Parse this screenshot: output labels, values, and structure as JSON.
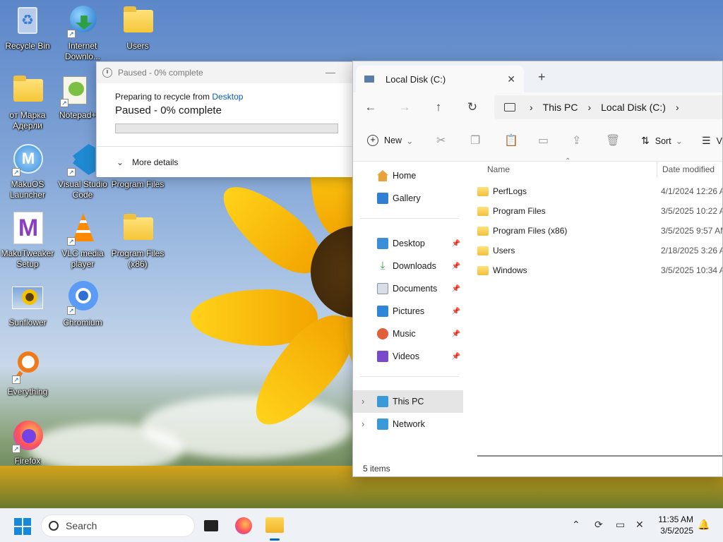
{
  "desktop": {
    "icons": [
      {
        "label": "Recycle Bin",
        "icon": "recycle-bin-icon"
      },
      {
        "label": "Internet Downlo...",
        "icon": "internet-download-manager-icon"
      },
      {
        "label": "Users",
        "icon": "folder-icon"
      },
      {
        "label": "от Марка Адерли",
        "icon": "folder-icon"
      },
      {
        "label": "Notepad++",
        "icon": "notepad-plus-plus-icon"
      },
      {
        "label": "MakuOS Launcher",
        "icon": "makuos-launcher-icon"
      },
      {
        "label": "Visual Studio Code",
        "icon": "vscode-icon"
      },
      {
        "label": "Program Files",
        "icon": "folder-icon"
      },
      {
        "label": "MakuTweaker Setup",
        "icon": "makutweaker-icon"
      },
      {
        "label": "VLC media player",
        "icon": "vlc-icon"
      },
      {
        "label": "Program Files (x86)",
        "icon": "folder-icon"
      },
      {
        "label": "Sunflower",
        "icon": "image-icon"
      },
      {
        "label": "Chromium",
        "icon": "chromium-icon"
      },
      {
        "label": "Everything",
        "icon": "everything-search-icon"
      },
      {
        "label": "Firefox",
        "icon": "firefox-icon"
      }
    ]
  },
  "dialog": {
    "title": "Paused - 0% complete",
    "preparing_prefix": "Preparing to recycle from ",
    "preparing_source": "Desktop",
    "status": "Paused - 0% complete",
    "progress_percent": 0,
    "more_details": "More details"
  },
  "explorer": {
    "tab_title": "Local Disk (C:)",
    "breadcrumb": [
      "This PC",
      "Local Disk (C:)"
    ],
    "toolbar": {
      "new_label": "New",
      "sort_label": "Sort",
      "view_label": "V"
    },
    "sidebar": {
      "home": "Home",
      "gallery": "Gallery",
      "pinned": [
        "Desktop",
        "Downloads",
        "Documents",
        "Pictures",
        "Music",
        "Videos"
      ],
      "this_pc": "This PC",
      "network": "Network"
    },
    "columns": {
      "name": "Name",
      "date": "Date modified"
    },
    "files": [
      {
        "name": "PerfLogs",
        "date": "4/1/2024 12:26 A"
      },
      {
        "name": "Program Files",
        "date": "3/5/2025 10:22 A"
      },
      {
        "name": "Program Files (x86)",
        "date": "3/5/2025 9:57 AM"
      },
      {
        "name": "Users",
        "date": "2/18/2025 3:26 A"
      },
      {
        "name": "Windows",
        "date": "3/5/2025 10:34 A"
      }
    ],
    "status": "5 items"
  },
  "taskbar": {
    "search_placeholder": "Search",
    "time": "11:35 AM",
    "date": "3/5/2025"
  },
  "colors": {
    "accent": "#0067c0",
    "link": "#0b5cad",
    "folder": "#f5c638"
  }
}
